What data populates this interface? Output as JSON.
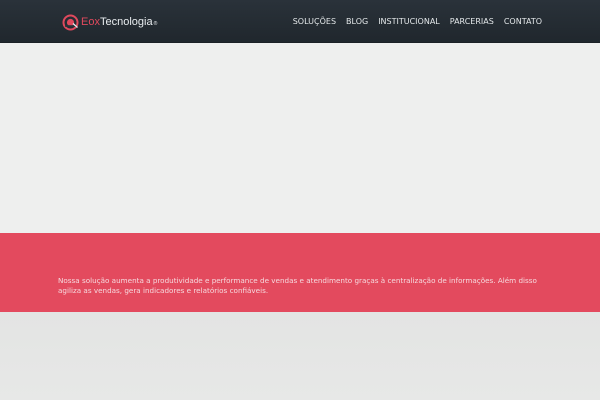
{
  "header": {
    "logo": {
      "brand_prefix": "Eox",
      "brand_suffix": "Tecnologia",
      "registered_mark": "®",
      "icon": "eox-logo-icon",
      "colors": {
        "accent": "#e0495d",
        "text": "#e8ecef"
      }
    },
    "nav": {
      "items": [
        {
          "label": "SOLUÇÕES"
        },
        {
          "label": "BLOG"
        },
        {
          "label": "INSTITUCIONAL"
        },
        {
          "label": "PARCERIAS"
        },
        {
          "label": "CONTATO"
        }
      ]
    },
    "background": "#252c33"
  },
  "hero": {
    "background": "#eeefee"
  },
  "band": {
    "text": "Nossa solução aumenta a produtividade e performance de vendas e atendimento graças à centralização de informações. Além disso agiliza as vendas, gera indicadores e relatórios confiáveis.",
    "background": "#e34a5e"
  }
}
